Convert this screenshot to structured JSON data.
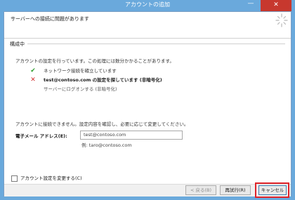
{
  "window": {
    "title": "アカウントの追加",
    "minimize_glyph": "—",
    "close_glyph": "✕"
  },
  "header": {
    "title": "サーバーへの接続に問題があります",
    "icon": "sun-burst-icon"
  },
  "section": {
    "label": "構成中"
  },
  "intro": "アカウントの設定を行っています。この処理には数分かかることがあります。",
  "steps": [
    {
      "icon": "check-icon",
      "glyph": "✔",
      "text": "ネットワーク接続を確立しています",
      "status": "done"
    },
    {
      "icon": "error-icon",
      "glyph": "✕",
      "text": "test@contoso.com の設定を探しています (非暗号化)",
      "status": "failed"
    },
    {
      "icon": "",
      "glyph": "",
      "text": "サーバーにログオンする (非暗号化)",
      "status": "pending"
    }
  ],
  "notice": "アカウントに接続できません。設定内容を確認し、必要に応じて変更してください。",
  "email": {
    "label": "電子メール アドレス(E):",
    "value": "test@contoso.com",
    "example": "例: taro@contoso.com"
  },
  "change_settings": {
    "label": "アカウント設定を変更する(C)",
    "checked": false
  },
  "buttons": {
    "back": "< 戻る(B)",
    "retry": "再試行(R)",
    "cancel": "キャンセル"
  },
  "colors": {
    "title_bar": "#6aa9dc",
    "close_button": "#c7382e",
    "success": "#2f9e2f",
    "error": "#d22b2b",
    "highlight": "#e0242a"
  }
}
